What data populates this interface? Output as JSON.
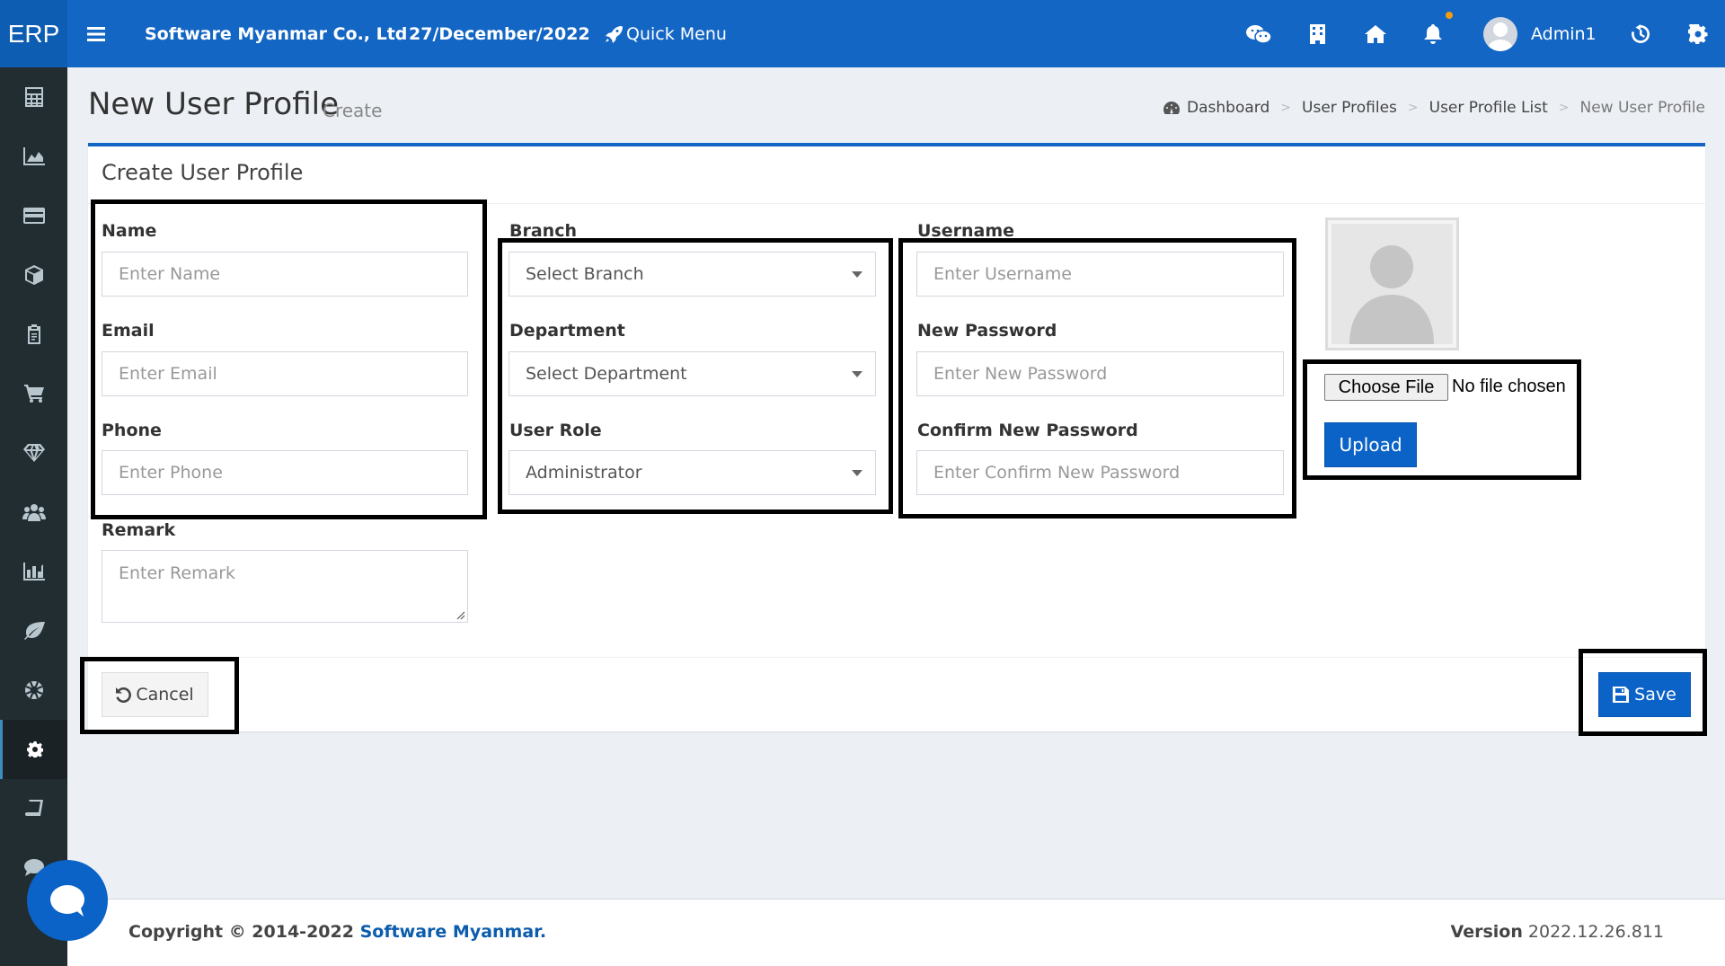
{
  "topbar": {
    "brand": "ERP",
    "company": "Software Myanmar Co., Ltd",
    "date": "27/December/2022",
    "quick_menu": "Quick Menu",
    "username": "Admin1",
    "icons": [
      "menu-icon",
      "rocket-icon",
      "wechat-icon",
      "building-icon",
      "home-icon",
      "bell-icon",
      "history-icon",
      "gear-icon"
    ]
  },
  "sidebar": {
    "items": [
      "calculator-icon",
      "area-chart-icon",
      "credit-card-icon",
      "cube-icon",
      "clipboard-icon",
      "cart-icon",
      "diamond-icon",
      "users-icon",
      "bar-chart-icon",
      "leaf-icon",
      "life-ring-icon",
      "gear-icon",
      "book-icon",
      "comment-icon"
    ],
    "active": "gear-icon"
  },
  "page": {
    "title": "New User Profile",
    "subtitle": "Create"
  },
  "breadcrumb": {
    "items": [
      "Dashboard",
      "User Profiles",
      "User Profile List",
      "New User Profile"
    ],
    "separator": ">"
  },
  "form": {
    "title": "Create User Profile",
    "name_label": "Name",
    "name_placeholder": "Enter Name",
    "email_label": "Email",
    "email_placeholder": "Enter Email",
    "phone_label": "Phone",
    "phone_placeholder": "Enter Phone",
    "remark_label": "Remark",
    "remark_placeholder": "Enter Remark",
    "branch_label": "Branch",
    "branch_value": "Select Branch",
    "department_label": "Department",
    "department_value": "Select Department",
    "role_label": "User Role",
    "role_value": "Administrator",
    "username_label": "Username",
    "username_placeholder": "Enter Username",
    "password_label": "New Password",
    "password_placeholder": "Enter New Password",
    "confirm_label": "Confirm New Password",
    "confirm_placeholder": "Enter Confirm New Password",
    "choose_file": "Choose File",
    "no_file": "No file chosen",
    "upload": "Upload",
    "cancel": "Cancel",
    "save": "Save"
  },
  "footer": {
    "copyright_prefix": "Copyright © 2014-2022",
    "copyright_link": "Software Myanmar.",
    "version_label": "Version",
    "version_value": "2022.12.26.811"
  },
  "colors": {
    "primary": "#1366c4",
    "sidebar": "#222d32",
    "background": "#ecf0f5"
  }
}
